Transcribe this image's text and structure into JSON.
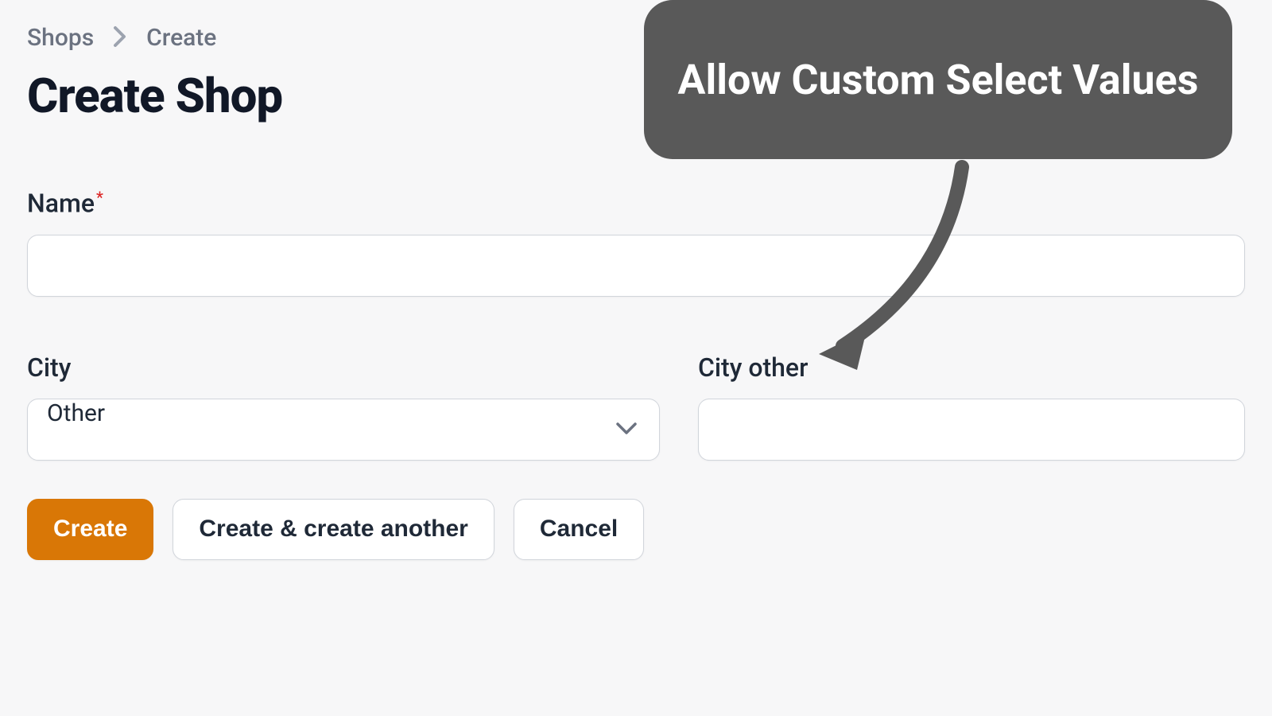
{
  "breadcrumb": {
    "parent": "Shops",
    "current": "Create"
  },
  "page": {
    "title": "Create Shop"
  },
  "form": {
    "name": {
      "label": "Name",
      "required": true,
      "value": ""
    },
    "city": {
      "label": "City",
      "selected": "Other"
    },
    "city_other": {
      "label": "City other",
      "value": ""
    }
  },
  "buttons": {
    "create": "Create",
    "create_another": "Create & create another",
    "cancel": "Cancel"
  },
  "callout": {
    "text": "Allow Custom Select Values"
  }
}
